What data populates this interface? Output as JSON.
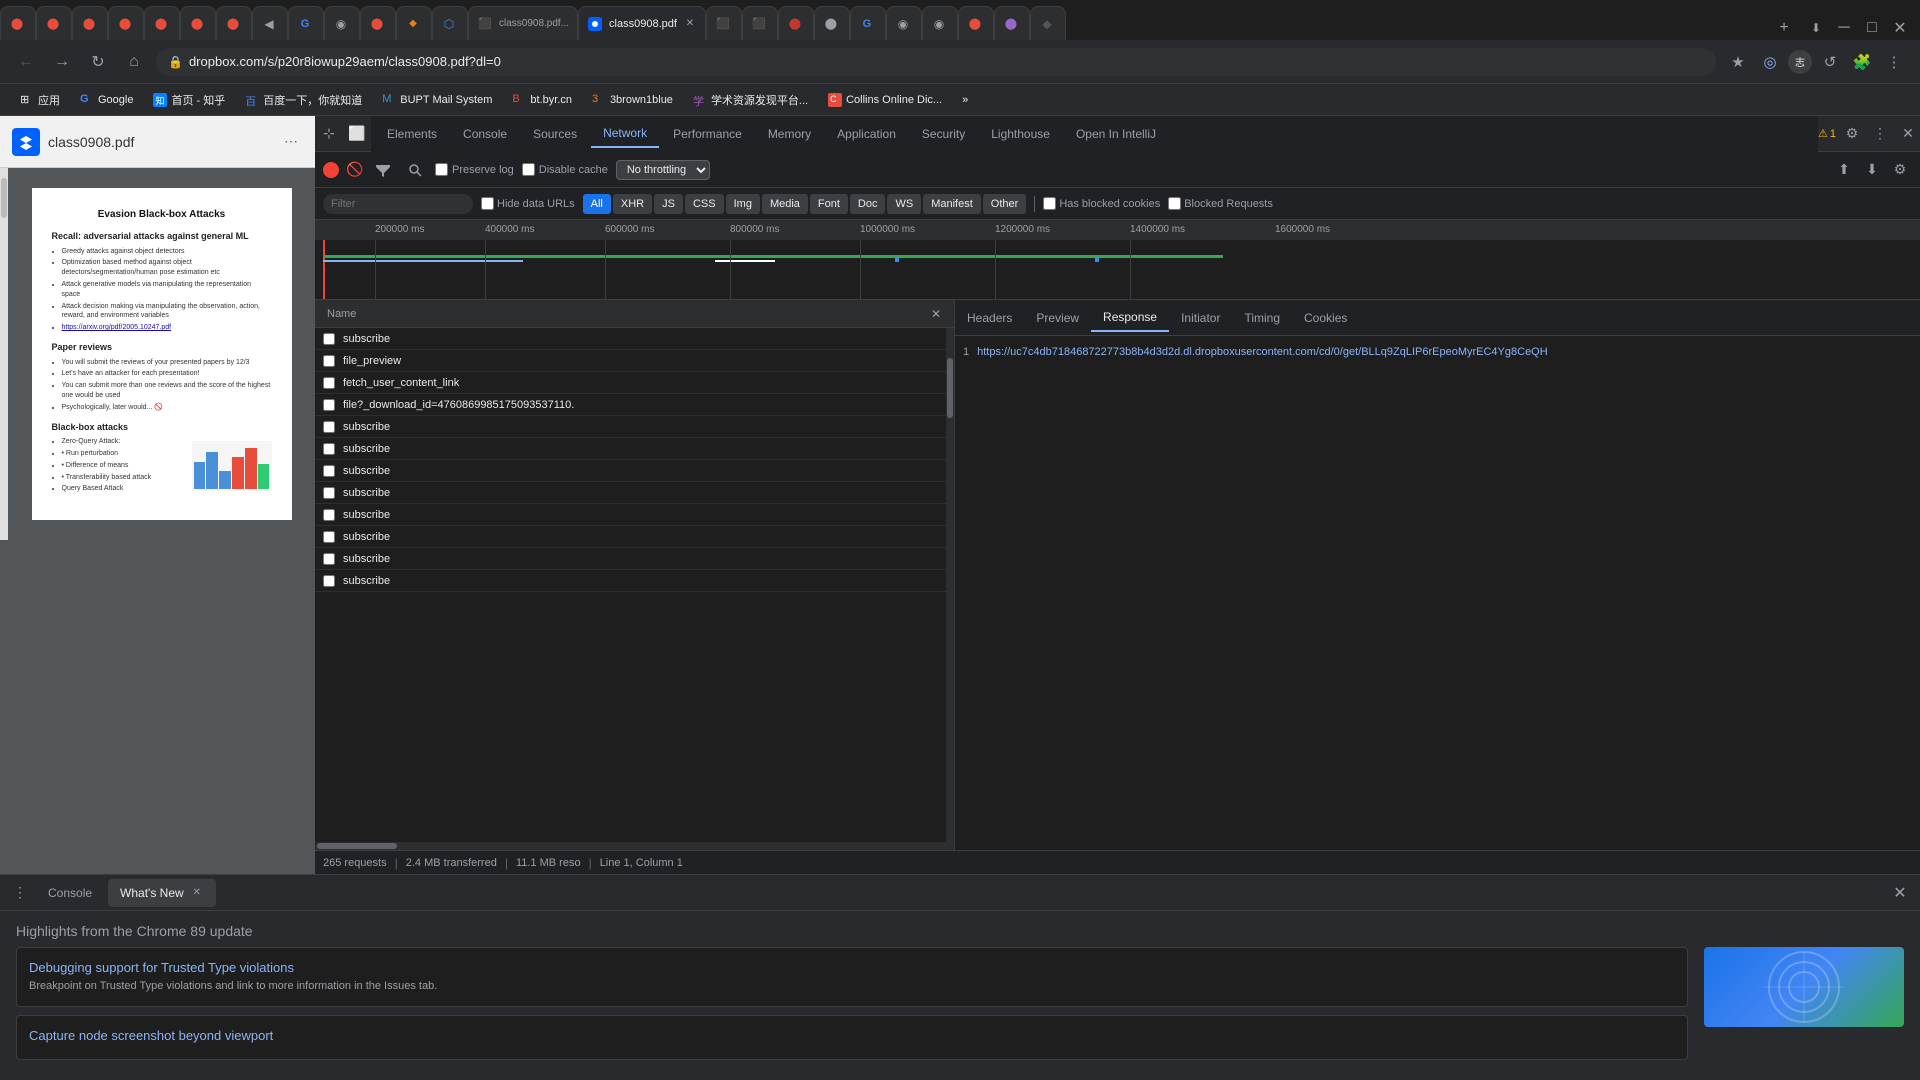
{
  "browser": {
    "tabs": [
      {
        "id": "t1",
        "favicon_color": "#e74c3c",
        "title": "●",
        "active": false
      },
      {
        "id": "t2",
        "favicon_color": "#e74c3c",
        "title": "●",
        "active": false
      },
      {
        "id": "t3",
        "favicon_color": "#e74c3c",
        "title": "●",
        "active": false
      },
      {
        "id": "t4",
        "favicon_color": "#e74c3c",
        "title": "●",
        "active": false
      },
      {
        "id": "t5",
        "favicon_color": "#e74c3c",
        "title": "●",
        "active": false
      },
      {
        "id": "t6",
        "favicon_color": "#e74c3c",
        "title": "●",
        "active": false
      },
      {
        "id": "t7",
        "favicon_color": "#e74c3c",
        "title": "●",
        "active": false
      },
      {
        "id": "t8",
        "favicon_color": "#9aa0a6",
        "title": "◀",
        "active": false
      },
      {
        "id": "t9",
        "favicon_color": "#4285f4",
        "title": "●",
        "active": false
      },
      {
        "id": "t10",
        "favicon_color": "#333",
        "title": "◉",
        "active": false
      },
      {
        "id": "t11",
        "favicon_color": "#e74c3c",
        "title": "●",
        "active": false
      },
      {
        "id": "t12",
        "favicon_color": "#e67e22",
        "title": "◆",
        "active": false
      },
      {
        "id": "t13",
        "favicon_color": "#4285f4",
        "title": "▲",
        "active": false
      },
      {
        "id": "t14",
        "favicon_color": "#3498db",
        "title": "◉",
        "active": false,
        "title_text": "class0908.pdf - Dr..."
      },
      {
        "id": "t15",
        "active": true,
        "title_text": "class0908.pdf",
        "favicon_color": "#0061ff"
      },
      {
        "id": "t16",
        "favicon_color": "#0061ff",
        "title": "●",
        "active": false
      },
      {
        "id": "t17",
        "favicon_color": "#0061ff",
        "title": "●",
        "active": false
      },
      {
        "id": "t18",
        "favicon_color": "#c0392b",
        "title": "●",
        "active": false
      },
      {
        "id": "t19",
        "favicon_color": "#c0392b",
        "title": "●",
        "active": false
      },
      {
        "id": "t20",
        "favicon_color": "#4285f4",
        "title": "G",
        "active": false
      }
    ],
    "url": "dropbox.com/s/p20r8iowup29aem/class0908.pdf?dl=0",
    "url_full": "dropbox.com/s/p20r8iowup29aem/class0908.pdf?dl=0"
  },
  "bookmarks": [
    {
      "label": "应用",
      "icon": "⊞"
    },
    {
      "label": "Google",
      "icon": "G"
    },
    {
      "label": "首页 - 知乎",
      "icon": "知"
    },
    {
      "label": "百度一下，你就知道",
      "icon": "百"
    },
    {
      "label": "BUPT Mail System",
      "icon": "M"
    },
    {
      "label": "bt.byr.cn",
      "icon": "B"
    },
    {
      "label": "3brown1blue",
      "icon": "3"
    },
    {
      "label": "学术资源发现平台...",
      "icon": "学"
    },
    {
      "label": "Collins Online Dic...",
      "icon": "C"
    }
  ],
  "pdf": {
    "title": "class0908.pdf",
    "page1_heading": "Evasion Black-box Attacks",
    "page1_section1": "Recall: adversarial attacks against general ML",
    "page1_bullets1": [
      "Greedy attacks against object detectors",
      "Optimization based method against object detectors/segmentation/human pose estimation etc",
      "Attack generative models via manipulating the representation space",
      "Attack decision making via manipulating the observation, action, reward, and environment variables",
      "https://arxiv.org/pdf/2005.10247.pdf"
    ],
    "page1_section2": "Paper reviews",
    "page1_bullets2": [
      "You will submit the reviews of your presented papers by 12/3",
      "Let's have an attacker for each presentation!",
      "You can submit more than one reviews and the score of the highest one would be used",
      "Psychologically, later would... 🚫"
    ],
    "page1_section3": "Black-box attacks",
    "page1_bullets3": [
      "Zero-Query Attack:",
      "• Run perturbation",
      "• Difference of means",
      "• Transferability based attack",
      "Query Based Attack"
    ]
  },
  "devtools": {
    "tabs": [
      "Elements",
      "Console",
      "Sources",
      "Network",
      "Performance",
      "Memory",
      "Application",
      "Security",
      "Lighthouse",
      "Open In IntelliJ"
    ],
    "active_tab": "Network",
    "warning_count": "1",
    "network": {
      "filter_placeholder": "Filter",
      "preserve_log_label": "Preserve log",
      "disable_cache_label": "Disable cache",
      "throttle_label": "No throttling",
      "filter_types": [
        "All",
        "XHR",
        "JS",
        "CSS",
        "Img",
        "Media",
        "Font",
        "Doc",
        "WS",
        "Manifest",
        "Other"
      ],
      "active_filter": "All",
      "hide_data_urls_label": "Hide data URLs",
      "has_blocked_cookies_label": "Has blocked cookies",
      "blocked_requests_label": "Blocked Requests",
      "timeline_ticks": [
        "200000 ms",
        "400000 ms",
        "600000 ms",
        "800000 ms",
        "1000000 ms",
        "1200000 ms",
        "1400000 ms",
        "1600000 ms"
      ],
      "request_list": {
        "header_name": "Name",
        "requests": [
          {
            "name": "subscribe"
          },
          {
            "name": "file_preview"
          },
          {
            "name": "fetch_user_content_link"
          },
          {
            "name": "file?_download_id=4760869985175093537110."
          },
          {
            "name": "subscribe"
          },
          {
            "name": "subscribe"
          },
          {
            "name": "subscribe"
          },
          {
            "name": "subscribe"
          },
          {
            "name": "subscribe"
          },
          {
            "name": "subscribe"
          },
          {
            "name": "subscribe"
          },
          {
            "name": "subscribe"
          }
        ]
      },
      "detail_tabs": [
        "Headers",
        "Preview",
        "Response",
        "Initiator",
        "Timing",
        "Cookies"
      ],
      "active_detail_tab": "Response",
      "response_line_num": "1",
      "response_url": "https://uc7c4db718468722773b8b4d3d2d.dl.dropboxusercontent.com/cd/0/get/BLLq9ZqLIP6rEpeoMyrEC4Yg8CeQH",
      "status_requests": "265 requests",
      "status_transferred": "2.4 MB transferred",
      "status_resources": "11.1 MB reso",
      "status_position": "Line 1, Column 1"
    }
  },
  "bottom_panel": {
    "menu_label": "⋮",
    "tabs": [
      {
        "label": "Console",
        "active": false
      },
      {
        "label": "What's New",
        "active": true,
        "closeable": true
      }
    ],
    "close_label": "✕",
    "whats_new": {
      "header": "Highlights from the Chrome 89 update",
      "items": [
        {
          "title": "Debugging support for Trusted Type violations",
          "description": "Breakpoint on Trusted Type violations and link to more information in the Issues tab."
        },
        {
          "title": "Capture node screenshot beyond viewport",
          "description": ""
        }
      ]
    }
  }
}
